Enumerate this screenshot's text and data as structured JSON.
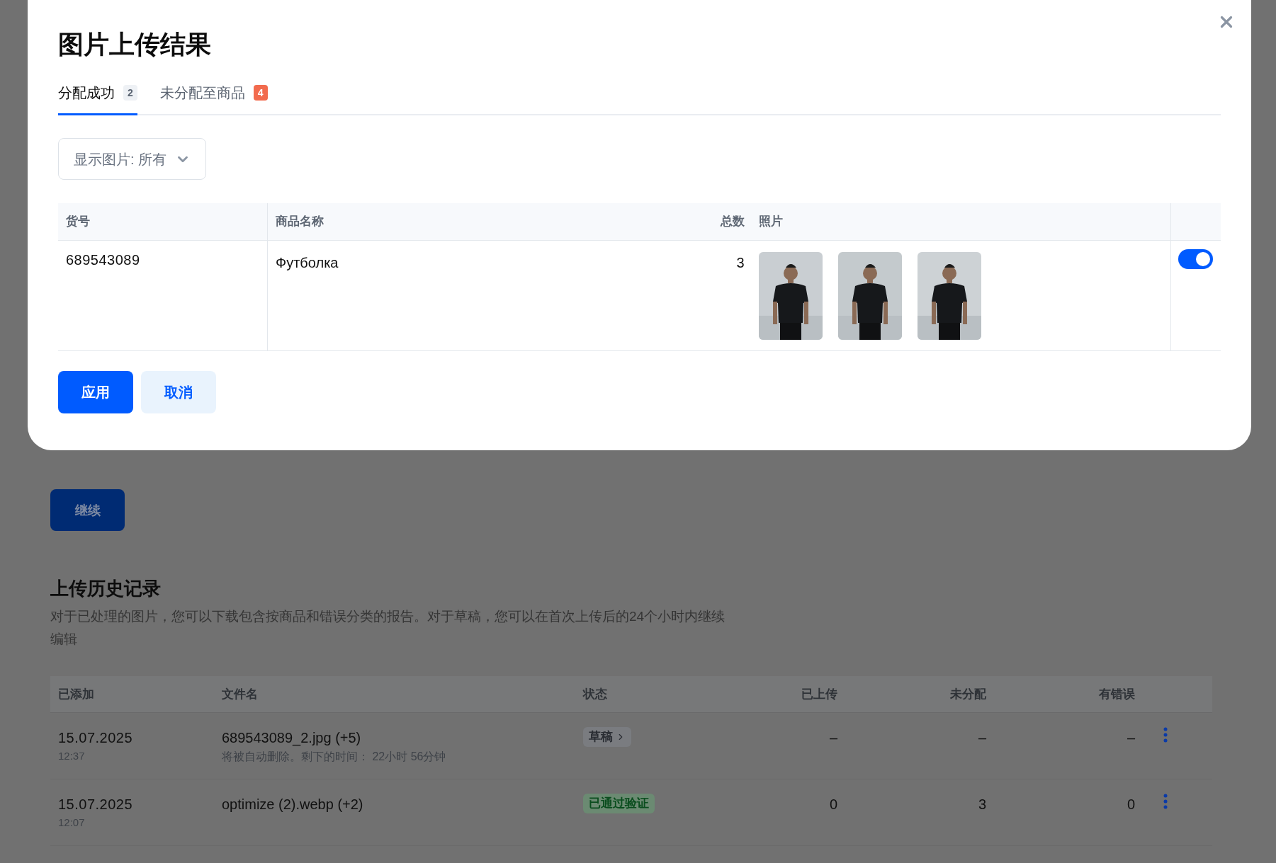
{
  "page": {
    "continue_button": "继续",
    "history": {
      "title": "上传历史记录",
      "description": "对于已处理的图片，您可以下载包含按商品和错误分类的报告。对于草稿，您可以在首次上传后的24个小时内继续编辑",
      "columns": [
        "已添加",
        "文件名",
        "状态",
        "已上传",
        "未分配",
        "有错误"
      ],
      "rows": [
        {
          "date": "15.07.2025",
          "time": "12:37",
          "filename": "689543089_2.jpg (+5)",
          "note": "将被自动删除。剩下的时间： 22小时 56分钟",
          "status": {
            "label": "草稿",
            "kind": "draft"
          },
          "uploaded": "–",
          "unassigned": "–",
          "errors": "–"
        },
        {
          "date": "15.07.2025",
          "time": "12:07",
          "filename": "optimize (2).webp (+2)",
          "status": {
            "label": "已通过验证",
            "kind": "verified"
          },
          "uploaded": "0",
          "unassigned": "3",
          "errors": "0"
        }
      ]
    }
  },
  "dialog": {
    "title": "图片上传结果",
    "tabs": [
      {
        "label": "分配成功",
        "count": "2",
        "kind": "neutral",
        "selected": true
      },
      {
        "label": "未分配至商品",
        "count": "4",
        "kind": "alert",
        "selected": false
      }
    ],
    "filter": {
      "value": "显示图片: 所有"
    },
    "table": {
      "columns": [
        "货号",
        "商品名称",
        "总数",
        "照片"
      ],
      "rows": [
        {
          "sku": "689543089",
          "name": "Футболка",
          "total": "3",
          "on": true
        }
      ]
    },
    "buttons": [
      {
        "label": "应用",
        "kind": "primary"
      },
      {
        "label": "取消",
        "kind": "secondary"
      }
    ]
  }
}
